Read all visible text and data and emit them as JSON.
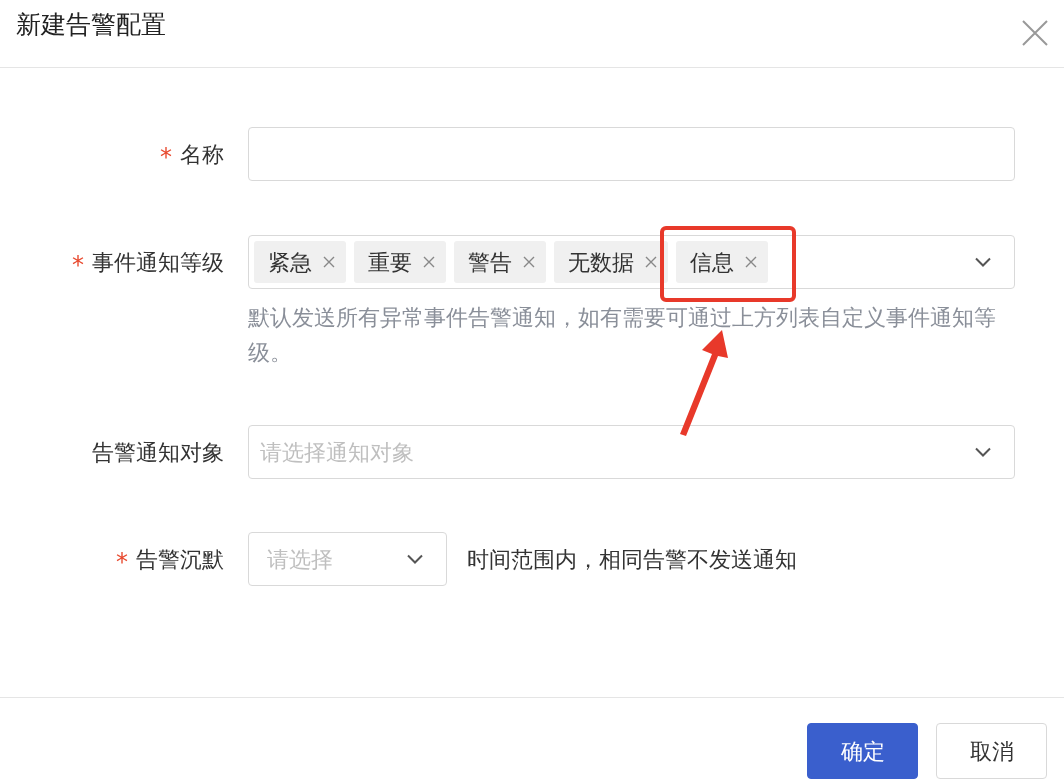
{
  "dialog": {
    "title": "新建告警配置"
  },
  "fields": [
    {
      "kind": "text",
      "label": "名称",
      "required_mark": "*"
    },
    {
      "kind": "tags",
      "label": "事件通知等级",
      "required_mark": "*",
      "tags": [
        "紧急",
        "重要",
        "警告",
        "无数据",
        "信息"
      ],
      "help": "默认发送所有异常事件告警通知，如有需要可通过上方列表自定义事件通知等级。"
    },
    {
      "kind": "select",
      "label": "告警通知对象",
      "placeholder": "请选择通知对象"
    },
    {
      "kind": "inline_select",
      "label": "告警沉默",
      "required_mark": "*",
      "placeholder": "请选择",
      "suffix": "时间范围内，相同告警不发送通知"
    }
  ],
  "buttons": [
    {
      "label": "确定",
      "kind": "primary"
    },
    {
      "label": "取消",
      "kind": "default"
    }
  ]
}
